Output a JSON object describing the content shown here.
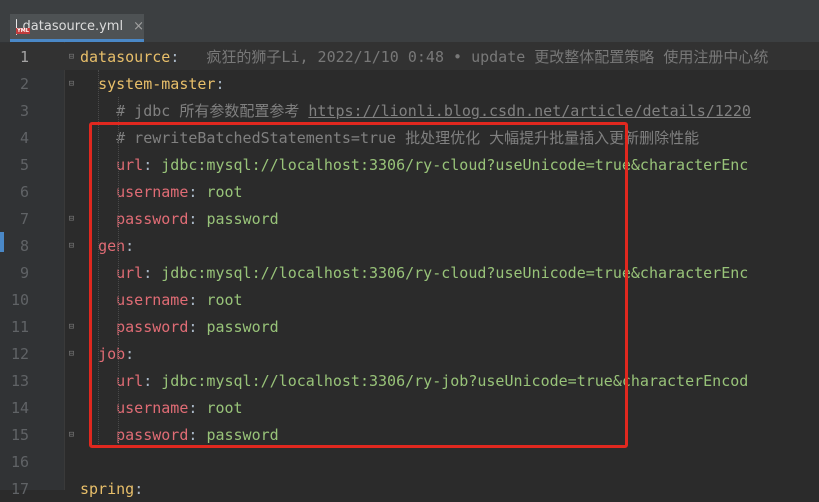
{
  "tab": {
    "filename": "datasource.yml",
    "close": "×"
  },
  "lines": [
    {
      "n": "1",
      "parts": [
        [
          "key1",
          "datasource"
        ],
        [
          "punc",
          ":"
        ],
        [
          "blame",
          "   疯狂的狮子Li, 2022/1/10 0:48 • update 更改整体配置策略 使用注册中心统"
        ]
      ]
    },
    {
      "n": "2",
      "parts": [
        [
          "sp",
          "  "
        ],
        [
          "key1",
          "system-master"
        ],
        [
          "punc",
          ":"
        ]
      ]
    },
    {
      "n": "3",
      "parts": [
        [
          "sp",
          "    "
        ],
        [
          "cmt",
          "# jdbc 所有参数配置参考 "
        ],
        [
          "cmt-link",
          "https://lionli.blog.csdn.net/article/details/1220"
        ]
      ]
    },
    {
      "n": "4",
      "parts": [
        [
          "sp",
          "    "
        ],
        [
          "cmt",
          "# rewriteBatchedStatements=true 批处理优化 大幅提升批量插入更新删除性能"
        ]
      ]
    },
    {
      "n": "5",
      "parts": [
        [
          "sp",
          "    "
        ],
        [
          "keyred",
          "url"
        ],
        [
          "punc",
          ": "
        ],
        [
          "val",
          "jdbc:mysql://localhost:3306/ry-cloud?useUnicode=true&characterEnc"
        ]
      ]
    },
    {
      "n": "6",
      "parts": [
        [
          "sp",
          "    "
        ],
        [
          "keyred",
          "username"
        ],
        [
          "punc",
          ": "
        ],
        [
          "val",
          "root"
        ]
      ]
    },
    {
      "n": "7",
      "parts": [
        [
          "sp",
          "    "
        ],
        [
          "keyred",
          "password"
        ],
        [
          "punc",
          ": "
        ],
        [
          "val",
          "password"
        ]
      ]
    },
    {
      "n": "8",
      "parts": [
        [
          "sp",
          "  "
        ],
        [
          "keyred",
          "gen"
        ],
        [
          "punc",
          ":"
        ]
      ]
    },
    {
      "n": "9",
      "parts": [
        [
          "sp",
          "    "
        ],
        [
          "keyred",
          "url"
        ],
        [
          "punc",
          ": "
        ],
        [
          "val",
          "jdbc:mysql://localhost:3306/ry-cloud?useUnicode=true&characterEnc"
        ]
      ]
    },
    {
      "n": "10",
      "parts": [
        [
          "sp",
          "    "
        ],
        [
          "keyred",
          "username"
        ],
        [
          "punc",
          ": "
        ],
        [
          "val",
          "root"
        ]
      ]
    },
    {
      "n": "11",
      "parts": [
        [
          "sp",
          "    "
        ],
        [
          "keyred",
          "password"
        ],
        [
          "punc",
          ": "
        ],
        [
          "val",
          "password"
        ]
      ]
    },
    {
      "n": "12",
      "parts": [
        [
          "sp",
          "  "
        ],
        [
          "keyred",
          "job"
        ],
        [
          "punc",
          ":"
        ]
      ]
    },
    {
      "n": "13",
      "parts": [
        [
          "sp",
          "    "
        ],
        [
          "keyred",
          "url"
        ],
        [
          "punc",
          ": "
        ],
        [
          "val",
          "jdbc:mysql://localhost:3306/ry-job?useUnicode=true&characterEncod"
        ]
      ]
    },
    {
      "n": "14",
      "parts": [
        [
          "sp",
          "    "
        ],
        [
          "keyred",
          "username"
        ],
        [
          "punc",
          ": "
        ],
        [
          "val",
          "root"
        ]
      ]
    },
    {
      "n": "15",
      "parts": [
        [
          "sp",
          "    "
        ],
        [
          "keyred",
          "password"
        ],
        [
          "punc",
          ": "
        ],
        [
          "val",
          "password"
        ]
      ]
    },
    {
      "n": "16",
      "parts": []
    },
    {
      "n": "17",
      "parts": [
        [
          "key1",
          "spring"
        ],
        [
          "punc",
          ":"
        ]
      ]
    }
  ],
  "folds": [
    "1",
    "2",
    "7",
    "8",
    "11",
    "12",
    "15"
  ],
  "colors": {
    "accent": "#4a88c7",
    "highlight": "#e0281f"
  }
}
